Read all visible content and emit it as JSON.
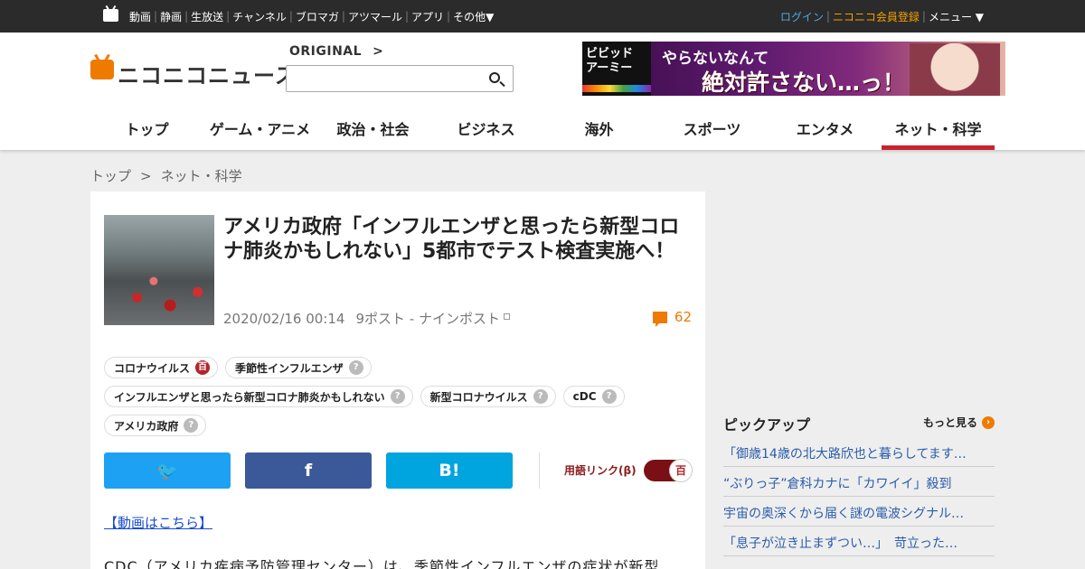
{
  "topbar": {
    "services": [
      "動画",
      "静画",
      "生放送",
      "チャンネル",
      "ブロマガ",
      "アツマール",
      "アプリ",
      "その他▼"
    ],
    "login": "ログイン",
    "register": "ニコニコ会員登録",
    "menu": "メニュー ▼"
  },
  "header": {
    "logo_text": "ニコニコニュース",
    "original_label": "ORIGINAL",
    "search": {
      "value": "",
      "placeholder": ""
    },
    "banner": {
      "brand": "ビビッド アーミー",
      "line1": "やらないなんて",
      "line2": "絶対許さない…っ！"
    }
  },
  "nav": {
    "items": [
      "トップ",
      "ゲーム・アニメ",
      "政治・社会",
      "ビジネス",
      "海外",
      "スポーツ",
      "エンタメ",
      "ネット・科学"
    ],
    "active_index": 7,
    "active_color": "#c8232c"
  },
  "breadcrumb": {
    "home": "トップ",
    "separator": ">",
    "current": "ネット・科学"
  },
  "article": {
    "title": "アメリカ政府「インフルエンザと思ったら新型コロナ肺炎かもしれない」5都市でテスト検査実施へ！",
    "date": "2020/02/16 00:14",
    "source": "9ポスト - ナインポスト",
    "comment_count": "62",
    "tags": [
      [
        {
          "label": "コロナウイルス",
          "badge": "百",
          "type": "dic"
        },
        {
          "label": "季節性インフルエンザ",
          "badge": "?",
          "type": "none"
        }
      ],
      [
        {
          "label": "インフルエンザと思ったら新型コロナ肺炎かもしれない",
          "badge": "?",
          "type": "none"
        },
        {
          "label": "新型コロナウイルス",
          "badge": "?",
          "type": "none"
        },
        {
          "label": "cDC",
          "badge": "?",
          "type": "none"
        }
      ],
      [
        {
          "label": "アメリカ政府",
          "badge": "?",
          "type": "none"
        }
      ]
    ],
    "share": {
      "twitter": "🐦",
      "facebook": "f",
      "hatena": "B!"
    },
    "term_link_label": "用語リンク(β)",
    "term_toggle_icon": "百",
    "video_link": "【動画はこちら】",
    "body_first_line": "CDC（アメリカ疾病予防管理センター）は、季節性インフルエンザの症状が新型"
  },
  "sidebar": {
    "pickup_title": "ピックアップ",
    "more_label": "もっと見る",
    "items": [
      "「御歳14歳の北大路欣也と暮らしてます…",
      "“ぶりっ子”倉科カナに「カワイイ」殺到",
      "宇宙の奥深くから届く謎の電波シグナル…",
      "「息子が泣き止まずつい…」　苛立った…"
    ]
  },
  "colors": {
    "brand_orange": "#ef7a00",
    "twitter": "#1da1f2",
    "facebook": "#3b5998",
    "hatena": "#00a4de"
  }
}
